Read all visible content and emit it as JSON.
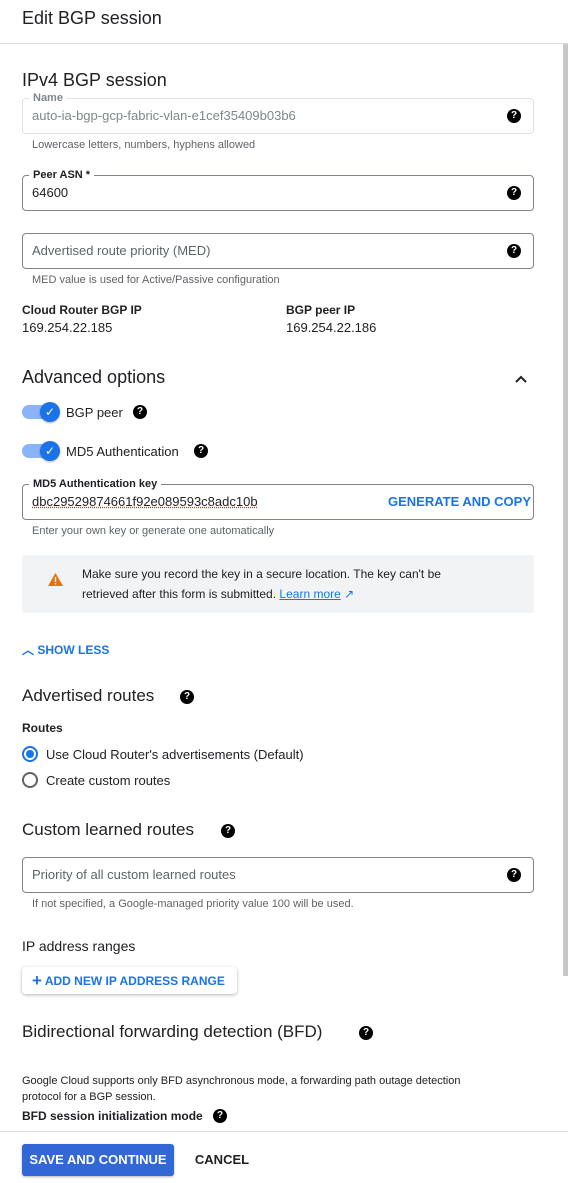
{
  "title": "Edit BGP session",
  "ipv4": {
    "heading": "IPv4 BGP session",
    "name": {
      "label": "Name",
      "value": "auto-ia-bgp-gcp-fabric-vlan-e1cef35409b03b6",
      "hint": "Lowercase letters, numbers, hyphens allowed"
    },
    "peer_asn": {
      "label": "Peer ASN *",
      "value": "64600"
    },
    "med": {
      "placeholder": "Advertised route priority (MED)",
      "hint": "MED value is used for Active/Passive configuration"
    },
    "router_ip": {
      "label": "Cloud Router BGP IP",
      "value": "169.254.22.185"
    },
    "peer_ip": {
      "label": "BGP peer IP",
      "value": "169.254.22.186"
    }
  },
  "advanced": {
    "heading": "Advanced options",
    "bgp_peer": {
      "label": "BGP peer",
      "on": true
    },
    "md5": {
      "label": "MD5 Authentication",
      "on": true
    },
    "md5_key": {
      "label": "MD5 Authentication key",
      "value": "dbc29529874661f92e089593c8adc10b",
      "action": "GENERATE AND COPY",
      "hint": "Enter your own key or generate one automatically"
    },
    "warning": {
      "line1": "Make sure you record the key in a secure location. The key can't be",
      "line2": "retrieved after this form is submitted.",
      "link": "Learn more",
      "color": "#e8710a"
    },
    "show_less": "SHOW LESS"
  },
  "advertised": {
    "heading": "Advertised routes",
    "routes_label": "Routes",
    "options": [
      "Use Cloud Router's advertisements (Default)",
      "Create custom routes"
    ],
    "selected": 0
  },
  "learned": {
    "heading": "Custom learned routes",
    "placeholder": "Priority of all custom learned routes",
    "hint": "If not specified, a Google-managed priority value 100 will be used.",
    "ip_ranges": "IP address ranges",
    "add_range": "ADD NEW IP ADDRESS RANGE"
  },
  "bfd": {
    "heading": "Bidirectional forwarding detection (BFD)",
    "desc1": "Google Cloud supports only BFD asynchronous mode, a forwarding path outage detection",
    "desc2": "protocol for a BGP session.",
    "mode_label": "BFD session initialization mode"
  },
  "footer": {
    "save": "SAVE AND CONTINUE",
    "cancel": "CANCEL"
  },
  "colors": {
    "accent": "#1a73e8",
    "primary_button": "#3367d6"
  }
}
